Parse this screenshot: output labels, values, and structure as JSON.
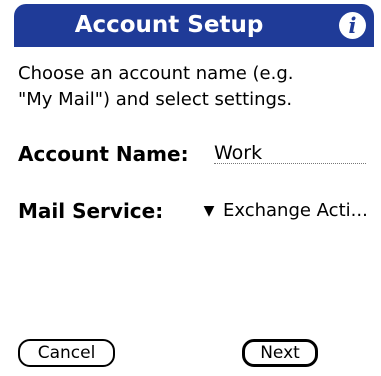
{
  "screen": {
    "title": "Account Setup",
    "info_icon": "information-icon",
    "instructions": "Choose an account name (e.g.\n\"My Mail\") and select settings.",
    "account_name": {
      "label": "Account Name:",
      "value": "Work"
    },
    "mail_service": {
      "label": "Mail Service:",
      "selected": "Exchange Acti..."
    },
    "buttons": {
      "cancel": "Cancel",
      "next": "Next"
    },
    "colors": {
      "title_bar": "#1f3b98",
      "background": "#ffffff",
      "text": "#000000"
    }
  }
}
